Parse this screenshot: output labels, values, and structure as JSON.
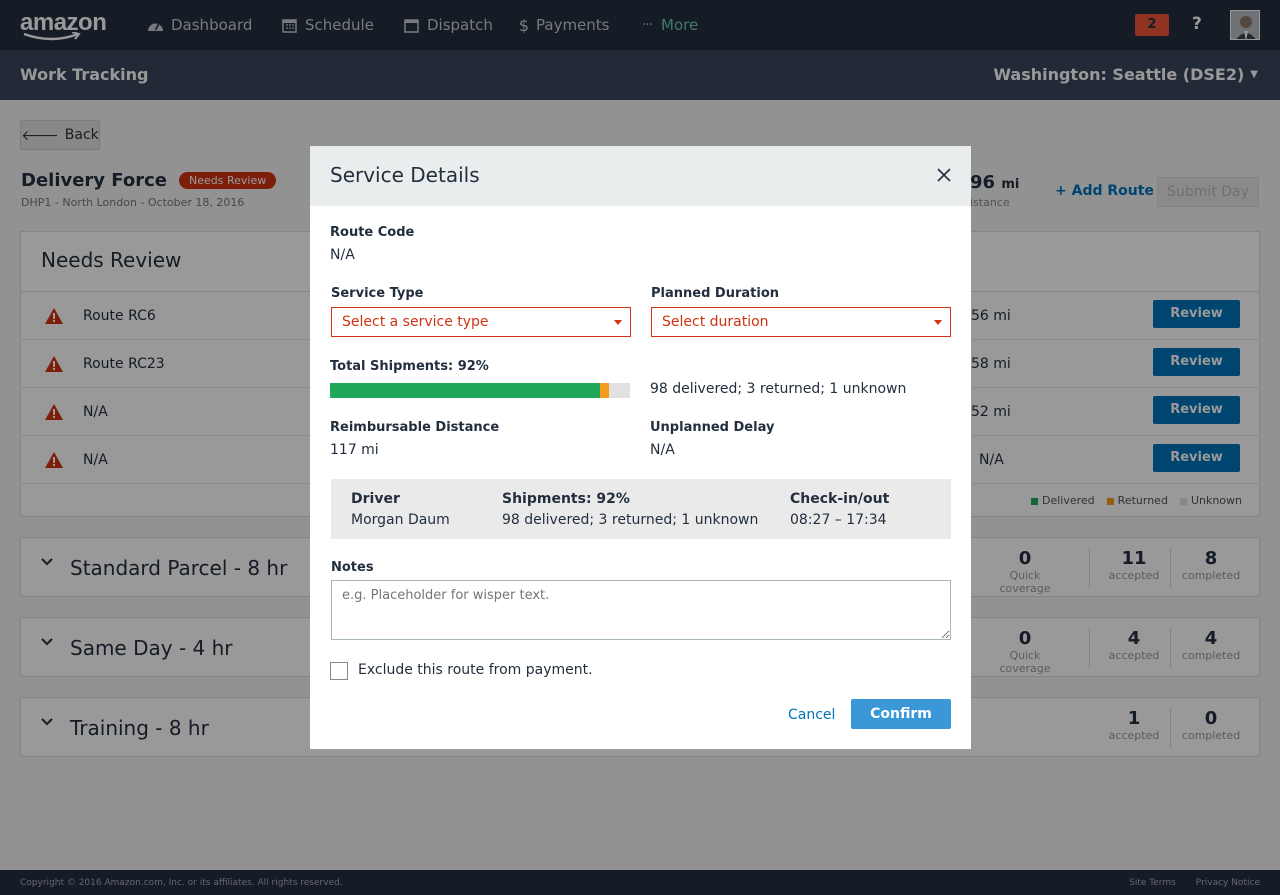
{
  "topnav": {
    "logo": "amazon",
    "items": [
      {
        "label": "Dashboard",
        "icon": "dashboard-icon"
      },
      {
        "label": "Schedule",
        "icon": "calendar-icon"
      },
      {
        "label": "Dispatch",
        "icon": "calendar-icon"
      },
      {
        "label": "Payments",
        "icon": "dollar-icon"
      },
      {
        "label": "More",
        "icon": "ellipsis-icon"
      }
    ],
    "notification_count": "2",
    "help": "?"
  },
  "subnav": {
    "title": "Work Tracking",
    "location": "Washington: Seattle (DSE2)"
  },
  "page": {
    "back_label": "Back",
    "title": "Delivery Force",
    "status_badge": "Needs Review",
    "subtitle": "DHP1 - North London - October 18, 2016",
    "miles_value": "96",
    "miles_unit": "mi",
    "miles_caption": "istance",
    "add_route": "+ Add Route",
    "submit_day": "Submit Day",
    "needs_review": {
      "heading": "Needs Review",
      "rows": [
        {
          "label": "Route RC6",
          "miles": "56 mi",
          "action": "Review"
        },
        {
          "label": "Route RC23",
          "miles": "58 mi",
          "action": "Review"
        },
        {
          "label": "N/A",
          "miles": "52 mi",
          "action": "Review"
        },
        {
          "label": "N/A",
          "miles": "N/A",
          "action": "Review"
        }
      ],
      "legend": [
        "Delivered",
        "Returned",
        "Unknown"
      ]
    },
    "groups": [
      {
        "title": "Standard Parcel - 8 hr",
        "stats": [
          {
            "n": "0",
            "t": "Quick coverage"
          },
          {
            "n": "11",
            "t": "accepted"
          },
          {
            "n": "8",
            "t": "completed"
          }
        ]
      },
      {
        "title": "Same Day - 4 hr",
        "stats": [
          {
            "n": "0",
            "t": "Quick coverage"
          },
          {
            "n": "4",
            "t": "accepted"
          },
          {
            "n": "4",
            "t": "completed"
          }
        ]
      },
      {
        "title": "Training - 8 hr",
        "stats": [
          {
            "n": "1",
            "t": "accepted"
          },
          {
            "n": "0",
            "t": "completed"
          }
        ]
      }
    ]
  },
  "modal": {
    "title": "Service Details",
    "route_code_label": "Route Code",
    "route_code_value": "N/A",
    "service_type_label": "Service Type",
    "service_type_placeholder": "Select a service type",
    "planned_duration_label": "Planned Duration",
    "planned_duration_placeholder": "Select duration",
    "total_shipments_label": "Total Shipments: 92%",
    "shipments_summary": "98 delivered; 3 returned; 1 unknown",
    "progress": {
      "delivered": 90,
      "returned": 3,
      "unknown": 7
    },
    "reimbursable_label": "Reimbursable Distance",
    "reimbursable_value": "117 mi",
    "delay_label": "Unplanned Delay",
    "delay_value": "N/A",
    "summary": {
      "driver_label": "Driver",
      "driver_value": "Morgan Daum",
      "shipments_label": "Shipments: 92%",
      "shipments_value": "98 delivered; 3 returned; 1 unknown",
      "checkin_label": "Check-in/out",
      "checkin_value": "08:27 – 17:34"
    },
    "notes_label": "Notes",
    "notes_placeholder": "e.g. Placeholder for wisper text.",
    "exclude_label": "Exclude this route from payment.",
    "cancel_label": "Cancel",
    "confirm_label": "Confirm"
  },
  "footer": {
    "copyright": "Copyright © 2016 Amazon.com, Inc. or its affiliates. All rights reserved.",
    "links": [
      "Site Terms",
      "Privacy Notice"
    ]
  },
  "colors": {
    "nav_bg": "#232f3e",
    "subnav_bg": "#37475a",
    "accent_blue": "#0073bb",
    "error_red": "#d13212",
    "delivered_green": "#1fa85a",
    "returned_orange": "#f59b1e",
    "unknown_gray": "#e1e1e1"
  }
}
